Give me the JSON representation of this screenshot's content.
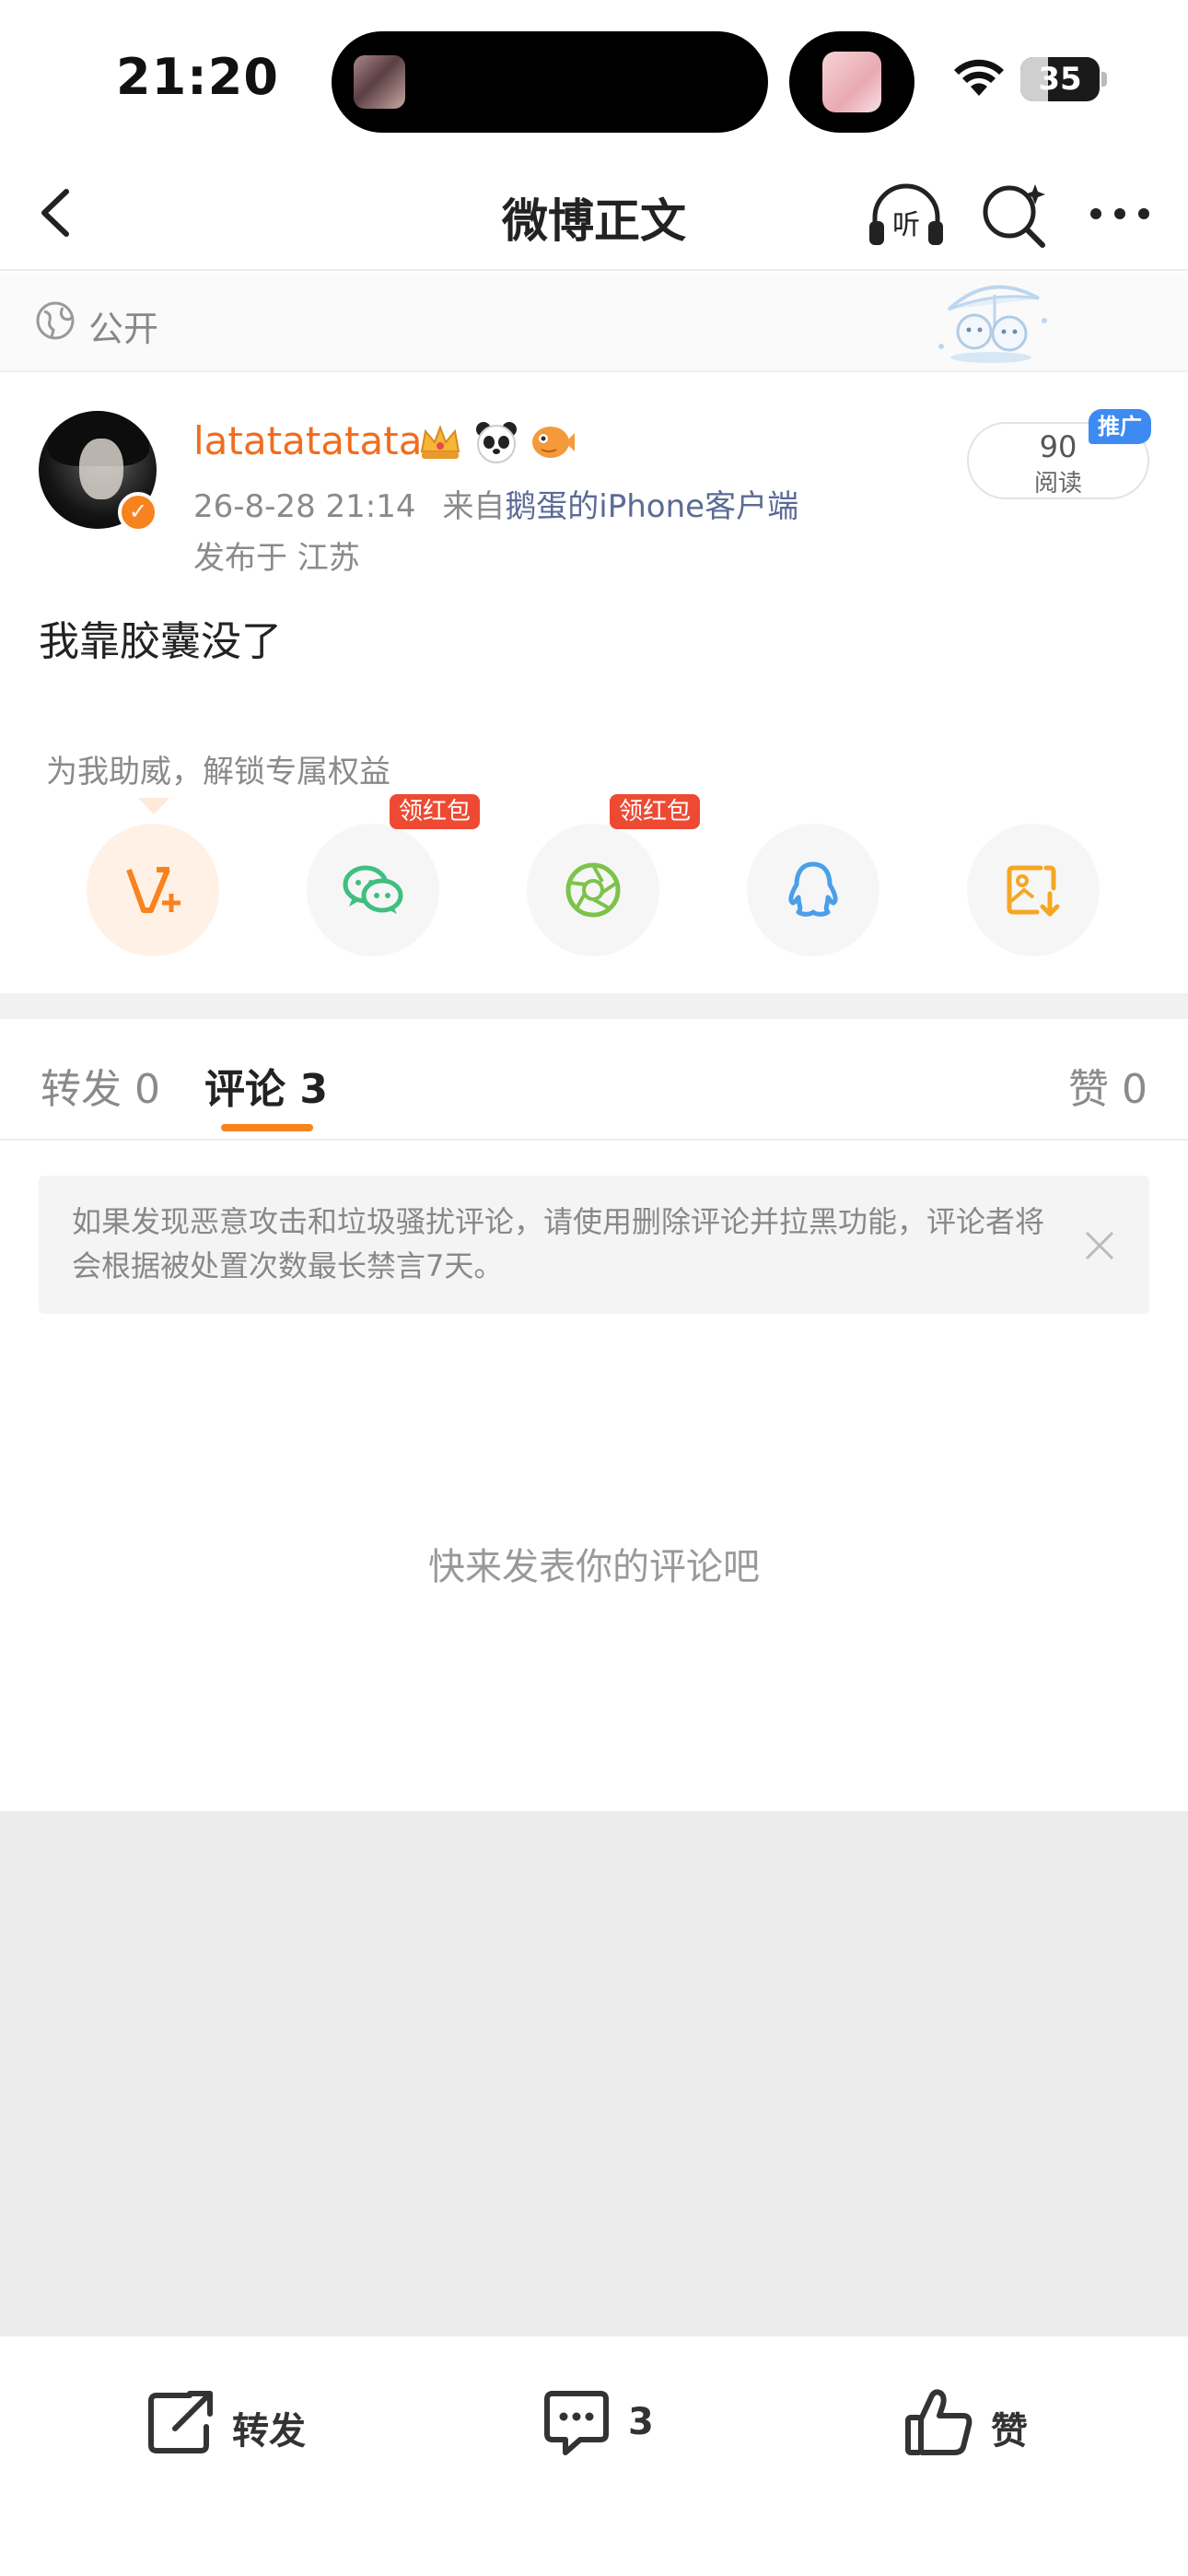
{
  "status_bar": {
    "time": "21:20",
    "battery": "35",
    "battery_level": 0.35
  },
  "nav": {
    "title": "微博正文",
    "listen_label": "听"
  },
  "visibility": {
    "label": "公开"
  },
  "post": {
    "username": "latatatatata",
    "badges": [
      "crown-badge",
      "panda-badge",
      "fish-badge"
    ],
    "date": "26-8-28 21:14",
    "source_prefix": "来自",
    "source": "鹅蛋的iPhone客户端",
    "location": "发布于 江苏",
    "read_count": "90",
    "read_label": "阅读",
    "promo_tag": "推广",
    "text": "我靠胶囊没了"
  },
  "share": {
    "hint": "为我助威，解锁专属权益",
    "buttons": [
      {
        "name": "weibo-vip",
        "tag": ""
      },
      {
        "name": "wechat",
        "tag": "领红包"
      },
      {
        "name": "moments",
        "tag": "领红包"
      },
      {
        "name": "qq",
        "tag": ""
      },
      {
        "name": "save-image",
        "tag": ""
      }
    ]
  },
  "tabs": {
    "repost": "转发 0",
    "comments": "评论 3",
    "likes": "赞 0"
  },
  "notice": {
    "text": "如果发现恶意攻击和垃圾骚扰评论，请使用删除评论并拉黑功能，评论者将会根据被处置次数最长禁言7天。"
  },
  "empty_state": {
    "text": "快来发表你的评论吧"
  },
  "bottom_bar": {
    "repost_label": "转发",
    "comment_label": "3",
    "like_label": "赞"
  },
  "colors": {
    "accent_orange": "#f7831f",
    "username_orange": "#f16d1e",
    "red_tag": "#ee4a33",
    "promo_blue": "#3d8bf2"
  }
}
